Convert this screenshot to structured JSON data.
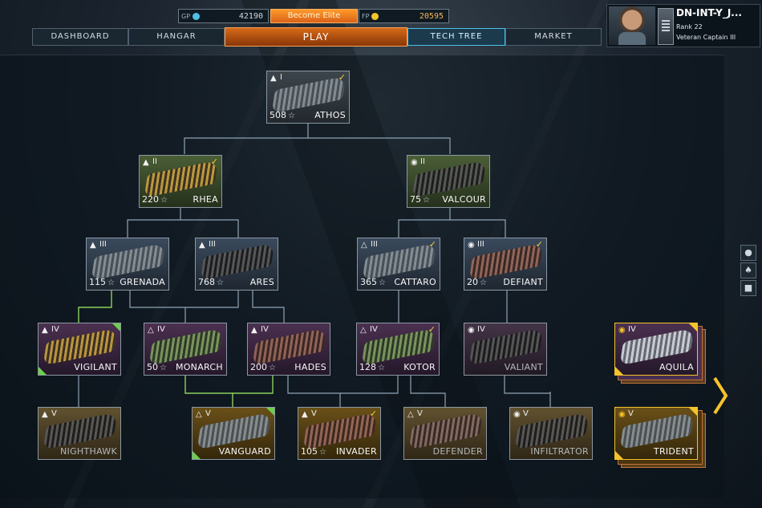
{
  "currency": {
    "gp_tag": "GP",
    "gp_value": "42190",
    "elite_label": "Become Elite",
    "fp_tag": "FP",
    "fp_value": "20595",
    "gp_color": "#4ec0e8",
    "fp_color": "#f5c32a"
  },
  "nav": {
    "dashboard": "DASHBOARD",
    "hangar": "HANGAR",
    "play": "PLAY",
    "tech_tree": "TECH TREE",
    "market": "MARKET"
  },
  "profile": {
    "name": "DN-INT-Y_J...",
    "rank": "Rank  22",
    "title": "Veteran Captain III"
  },
  "side_icons": [
    "squad-icon",
    "friends-icon",
    "chat-icon"
  ],
  "colors": {
    "line": "#8fa3b4",
    "line_active": "#8ad05a",
    "check": "#f5d23a",
    "play_accent": "#d46a18",
    "tech_accent": "#4ec0e8"
  },
  "ships": {
    "athos": {
      "tier": "I",
      "num": "508",
      "name": "ATHOS",
      "owned": true
    },
    "rhea": {
      "tier": "II",
      "num": "220",
      "name": "RHEA",
      "owned": true
    },
    "valcour": {
      "tier": "II",
      "num": "75",
      "name": "VALCOUR",
      "owned": false
    },
    "grenada": {
      "tier": "III",
      "num": "115",
      "name": "GRENADA",
      "owned": false
    },
    "ares": {
      "tier": "III",
      "num": "768",
      "name": "ARES",
      "owned": false
    },
    "cattaro": {
      "tier": "III",
      "num": "365",
      "name": "CATTARO",
      "owned": true
    },
    "defiant": {
      "tier": "III",
      "num": "20",
      "name": "DEFIANT",
      "owned": true
    },
    "vigilant": {
      "tier": "IV",
      "num": "",
      "name": "VIGILANT",
      "owned": false
    },
    "monarch": {
      "tier": "IV",
      "num": "50",
      "name": "MONARCH",
      "owned": false
    },
    "hades": {
      "tier": "IV",
      "num": "200",
      "name": "HADES",
      "owned": false
    },
    "kotor": {
      "tier": "IV",
      "num": "128",
      "name": "KOTOR",
      "owned": true
    },
    "valiant": {
      "tier": "IV",
      "num": "",
      "name": "VALIANT",
      "owned": false
    },
    "aquila": {
      "tier": "IV",
      "num": "",
      "name": "AQUILA",
      "owned": false
    },
    "nighthawk": {
      "tier": "V",
      "num": "",
      "name": "NIGHTHAWK",
      "owned": false
    },
    "vanguard": {
      "tier": "V",
      "num": "",
      "name": "VANGUARD",
      "owned": false
    },
    "invader": {
      "tier": "V",
      "num": "105",
      "name": "INVADER",
      "owned": true
    },
    "defender": {
      "tier": "V",
      "num": "",
      "name": "DEFENDER",
      "owned": false
    },
    "infiltrator": {
      "tier": "V",
      "num": "",
      "name": "INFILTRATOR",
      "owned": false
    },
    "trident": {
      "tier": "V",
      "num": "",
      "name": "TRIDENT",
      "owned": false
    }
  }
}
